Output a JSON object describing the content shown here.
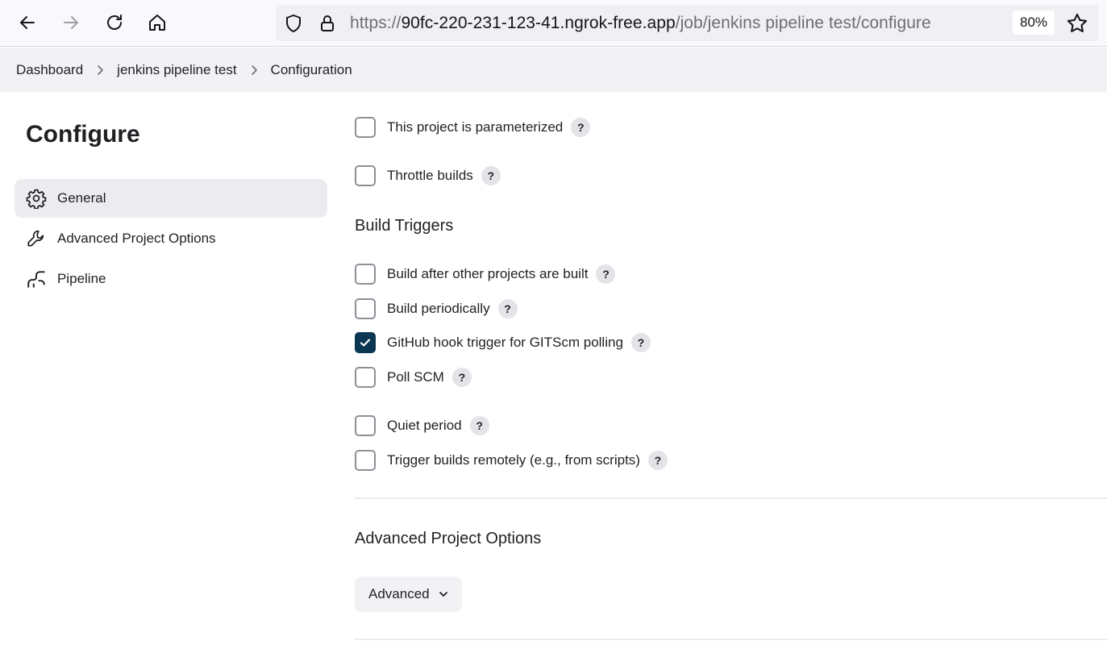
{
  "browser": {
    "url_protocol": "https://",
    "url_host": "90fc-220-231-123-41.ngrok-free.app",
    "url_path": "/job/jenkins pipeline test/configure",
    "zoom": "80%"
  },
  "breadcrumbs": [
    "Dashboard",
    "jenkins pipeline test",
    "Configuration"
  ],
  "sidebar": {
    "title": "Configure",
    "items": [
      {
        "label": "General",
        "icon": "gear-icon",
        "active": true
      },
      {
        "label": "Advanced Project Options",
        "icon": "wrench-icon",
        "active": false
      },
      {
        "label": "Pipeline",
        "icon": "pipeline-icon",
        "active": false
      }
    ]
  },
  "general": {
    "options": [
      {
        "label": "This project is parameterized",
        "checked": false,
        "help": "?"
      },
      {
        "label": "Throttle builds",
        "checked": false,
        "help": "?"
      }
    ]
  },
  "build_triggers": {
    "title": "Build Triggers",
    "options": [
      {
        "label": "Build after other projects are built",
        "checked": false,
        "help": "?"
      },
      {
        "label": "Build periodically",
        "checked": false,
        "help": "?"
      },
      {
        "label": "GitHub hook trigger for GITScm polling",
        "checked": true,
        "help": "?"
      },
      {
        "label": "Poll SCM",
        "checked": false,
        "help": "?"
      },
      {
        "label": "Quiet period",
        "checked": false,
        "help": "?"
      },
      {
        "label": "Trigger builds remotely (e.g., from scripts)",
        "checked": false,
        "help": "?"
      }
    ]
  },
  "advanced_options": {
    "title": "Advanced Project Options",
    "button_label": "Advanced"
  },
  "colors": {
    "checkbox_checked": "#0c3752",
    "active_nav_bg": "#ececf0"
  }
}
